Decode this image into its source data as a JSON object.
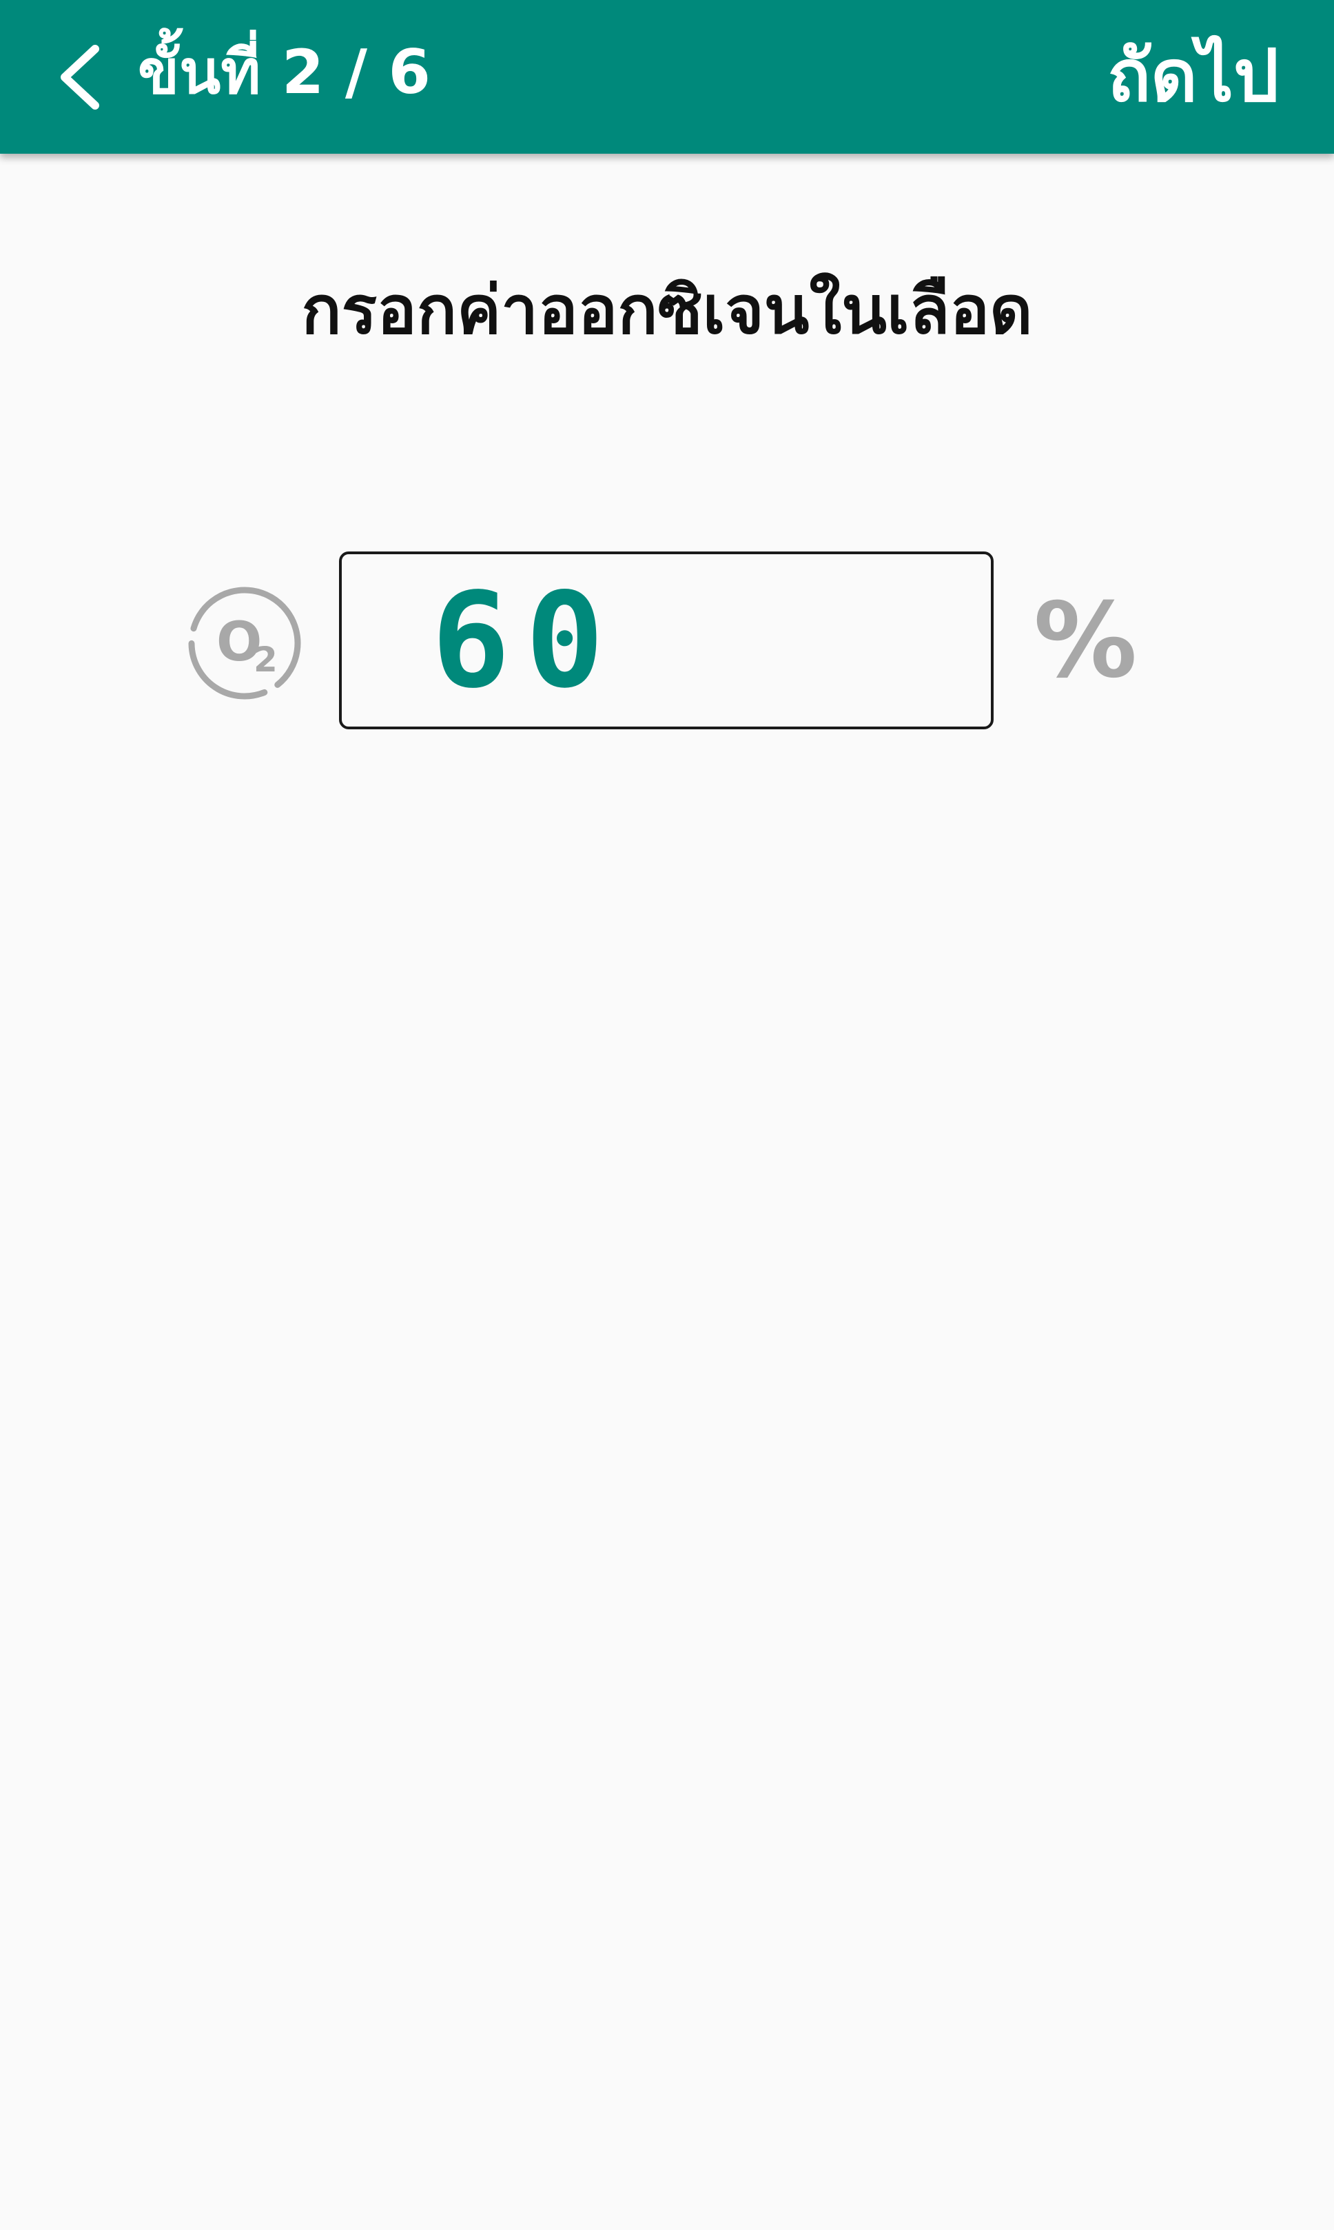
{
  "header": {
    "back_icon": "chevron-left-icon",
    "step_label": "ขั้นที่ 2 / 6",
    "next_label": "ถัดไป",
    "background_color": "#00897b",
    "text_color": "#ffffff"
  },
  "main": {
    "heading": "กรอกค่าออกซิเจนในเลือด",
    "oxygen_icon": "oxygen-o2-icon",
    "oxygen_value": "60",
    "unit": "%",
    "value_color": "#00897b",
    "unit_color": "#a8a8a8"
  }
}
